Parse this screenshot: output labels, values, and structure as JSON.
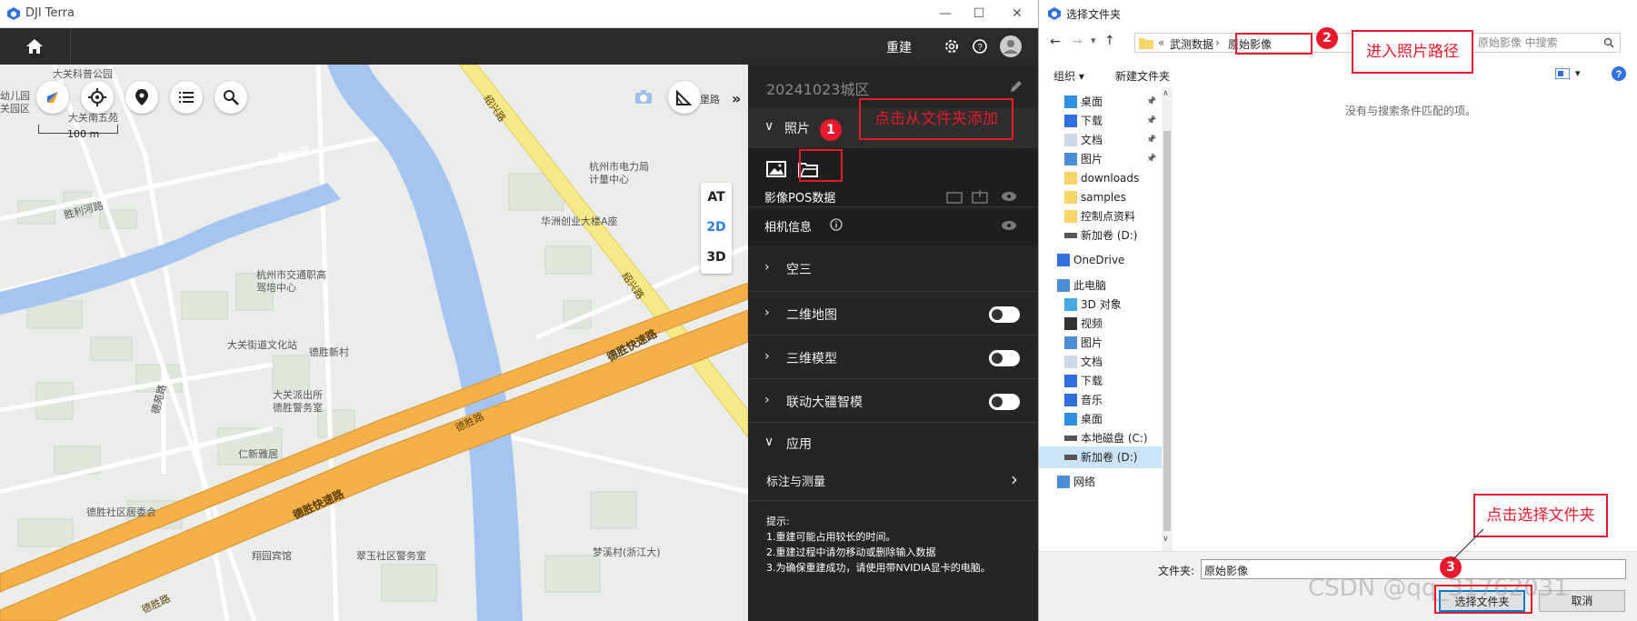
{
  "terra": {
    "title": "DJI Terra",
    "rebuild": "重建",
    "project": "20241023城区",
    "photos": "照片",
    "pos": "影像POS数据",
    "camera": "相机信息",
    "at": "空三",
    "map2d": "二维地图",
    "model3d": "三维模型",
    "linkage": "联动大疆智模",
    "apps": "应用",
    "measure": "标注与测量",
    "tips_title": "提示:",
    "tip1": "1.重建可能占用较长的时间。",
    "tip2": "2.重建过程中请勿移动或删除输入数据",
    "tip3": "3.为确保重建成功，请使用带NVIDIA显卡的电脑。"
  },
  "map": {
    "scale": "100 m",
    "view_at": "AT",
    "view_2d": "2D",
    "view_3d": "3D",
    "labels": {
      "l1": "大关科普公园",
      "l2": "幼儿园",
      "l3": "关园区",
      "l4": "大关南五苑",
      "l5": "胜利河路",
      "l6": "杭州市电力局",
      "l7": "计量中心",
      "l8": "华洲创业大楼A座",
      "l9": "杭州市交通职高",
      "l10": "驾培中心",
      "l11": "大关街道文化站",
      "l12": "德胜新村",
      "l13": "大关派出所",
      "l14": "德胜警务室",
      "l15": "仁新雅居",
      "l16": "德胜社区居委会",
      "l17": "翔园宾馆",
      "l18": "翠玉社区警务室",
      "l19": "梦溪村(浙江大)",
      "r1": "胜利河",
      "r2": "德胜快速路",
      "r3": "德胜路",
      "r4": "德胜快速路",
      "r5": "德胜路",
      "r6": "绍兴路",
      "r7": "绍兴路",
      "r8": "德苑路",
      "r9": "堡路"
    }
  },
  "annotations": {
    "a1": "点击从文件夹添加",
    "a2": "进入照片路径",
    "a3": "点击选择文件夹",
    "n1": "1",
    "n2": "2",
    "n3": "3"
  },
  "dialog": {
    "title": "选择文件夹",
    "path_sep": "«",
    "path1": "武测数据",
    "path2": "原始影像",
    "search": "在 原始影像 中搜索",
    "organize": "组织 ▾",
    "newfolder": "新建文件夹",
    "empty": "没有与搜索条件匹配的项。",
    "nav": [
      "桌面",
      "下载",
      "文档",
      "图片",
      "downloads",
      "samples",
      "控制点资料",
      "新加卷 (D:)",
      "OneDrive",
      "此电脑",
      "3D 对象",
      "视频",
      "图片",
      "文档",
      "下载",
      "音乐",
      "桌面",
      "本地磁盘 (C:)",
      "新加卷 (D:)",
      "网络"
    ],
    "folder_label": "文件夹:",
    "folder_value": "原始影像",
    "select": "选择文件夹",
    "cancel": "取消",
    "watermark": "CSDN @qq_31762031"
  },
  "colors": {
    "accent": "#e8192c",
    "road": "#f4b14a",
    "river": "#a6c4f0"
  }
}
